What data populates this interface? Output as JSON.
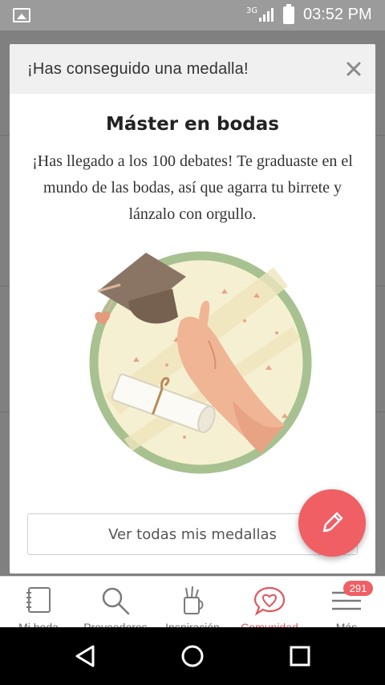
{
  "status_bar": {
    "network": "3G",
    "time": "03:52 PM"
  },
  "modal": {
    "header_title": "¡Has conseguido una medalla!",
    "close_symbol": "✕",
    "medal_name": "Máster en bodas",
    "message": "¡Has llegado a los 100 debates! Te graduaste en el mundo de las bodas, así que agarra tu birrete y lánzalo con orgullo.",
    "all_medals_label": "Ver todas mis medallas"
  },
  "fab": {
    "icon": "pencil-icon"
  },
  "bottom_nav": {
    "items": [
      {
        "label": "Mi boda",
        "icon": "notebook-icon"
      },
      {
        "label": "Proveedores",
        "icon": "search-icon"
      },
      {
        "label": "Inspiración",
        "icon": "pencil-cup-icon"
      },
      {
        "label": "Comunidad",
        "icon": "chat-heart-icon",
        "active": true
      },
      {
        "label": "Más",
        "icon": "menu-icon"
      }
    ],
    "badge_count": "291"
  },
  "colors": {
    "accent": "#ef5f64",
    "backdrop": "#808080",
    "header_bg": "#f0f0f0",
    "medal_ring": "#a8c190",
    "medal_bg": "#f6f0d2"
  }
}
